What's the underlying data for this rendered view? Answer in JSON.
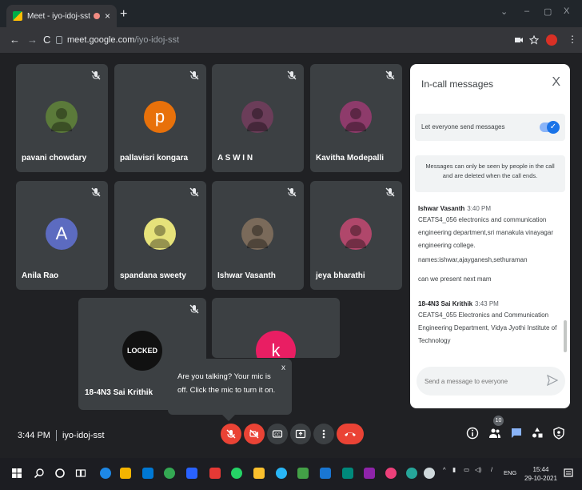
{
  "browser": {
    "tab_title": "Meet - iyo-idoj-sst",
    "tab_close": "×",
    "new_tab": "+",
    "url_host": "meet.google.com",
    "url_path": "/iyo-idoj-sst",
    "window_controls": [
      "⌄",
      "–",
      "▢",
      "X"
    ]
  },
  "participants": [
    {
      "name": "pavani chowdary",
      "avatar_type": "photo",
      "avatar_color": "#5b7a3a"
    },
    {
      "name": "pallavisri kongara",
      "avatar_type": "letter",
      "avatar_letter": "p",
      "avatar_color": "#e8710a"
    },
    {
      "name": "A S W I N",
      "avatar_type": "photo",
      "avatar_color": "#6b3d59"
    },
    {
      "name": "Kavitha Modepalli",
      "avatar_type": "photo",
      "avatar_color": "#8e3b6b"
    },
    {
      "name": "Anila Rao",
      "avatar_type": "letter",
      "avatar_letter": "A",
      "avatar_color": "#5c6bc0"
    },
    {
      "name": "spandana sweety",
      "avatar_type": "photo",
      "avatar_color": "#e6e27a"
    },
    {
      "name": "Ishwar Vasanth",
      "avatar_type": "photo",
      "avatar_color": "#7a6a5a"
    },
    {
      "name": "jeya bharathi",
      "avatar_type": "photo",
      "avatar_color": "#b0476b"
    },
    {
      "name": "18-4N3 Sai Krithik",
      "avatar_type": "logo",
      "avatar_text": "LOCKED",
      "avatar_color": "#111111"
    },
    {
      "name": "",
      "avatar_type": "letter",
      "avatar_letter": "k",
      "avatar_color": "#e91e63"
    }
  ],
  "chat": {
    "title": "In-call messages",
    "close": "X",
    "setting_label": "Let everyone send messages",
    "notice": "Messages can only be seen by people in the call and are deleted when the call ends.",
    "messages": [
      {
        "sender": "Ishwar Vasanth",
        "time": "3:40 PM",
        "lines": [
          "CEATS4_056 electronics and communication engineering department,sri manakula vinayagar engineering college.",
          "names:ishwar,ajayganesh,sethuraman",
          "can we present next mam"
        ]
      },
      {
        "sender": "18-4N3 Sai Krithik",
        "time": "3:43 PM",
        "lines": [
          "CEATS4_055 Electronics and Communication Engineering Department, Vidya Jyothi Institute of Technology"
        ]
      }
    ],
    "input_placeholder": "Send a message to everyone"
  },
  "tooltip": {
    "text": "Are you talking? Your mic is off. Click the mic to turn it on.",
    "close": "x"
  },
  "bottom_bar": {
    "time": "3:44 PM",
    "meeting_code": "iyo-idoj-sst",
    "participant_count": "10"
  },
  "taskbar": {
    "lang": "ENG",
    "time": "15:44",
    "date": "29-10-2021"
  },
  "colors": {
    "background": "#202124",
    "tile": "#3c4043",
    "danger": "#ea4335",
    "accent": "#1a73e8"
  }
}
